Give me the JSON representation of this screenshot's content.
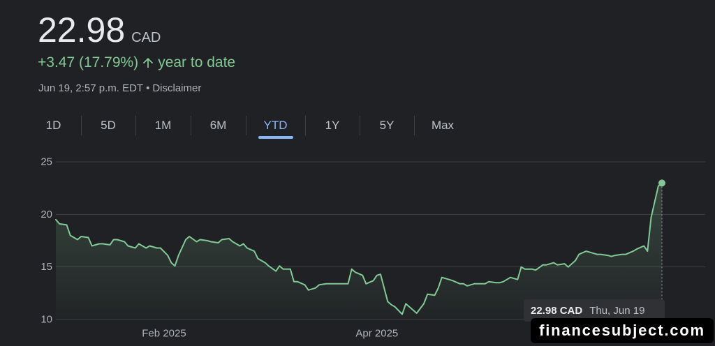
{
  "quote": {
    "price": "22.98",
    "currency": "CAD",
    "change": "+3.47 (17.79%)",
    "change_icon": "arrow-up-icon",
    "change_period": "year to date",
    "timestamp": "Jun 19, 2:57 p.m. EDT",
    "separator": "•",
    "disclaimer": "Disclaimer"
  },
  "range_tabs": {
    "items": [
      "1D",
      "5D",
      "1M",
      "6M",
      "YTD",
      "1Y",
      "5Y",
      "Max"
    ],
    "selected": "YTD"
  },
  "colors": {
    "background": "#202124",
    "text": "#e8eaed",
    "positive": "#81c995",
    "muted": "#9aa0a6",
    "accent": "#8ab4f8",
    "grid": "#3c4043"
  },
  "watermark": "financesubject.com",
  "chart_data": {
    "type": "line",
    "xlim": [
      "2025-01-02",
      "2025-06-19"
    ],
    "ylim": [
      10,
      25
    ],
    "grid": true,
    "y_ticks": [
      {
        "value": 25,
        "label": "25"
      },
      {
        "value": 20,
        "label": "20"
      },
      {
        "value": 15,
        "label": "15"
      },
      {
        "value": 10,
        "label": "10"
      }
    ],
    "x_ticks": [
      {
        "value": "2025-02-01",
        "label": "Feb 2025"
      },
      {
        "value": "2025-04-01",
        "label": "Apr 2025"
      }
    ],
    "series": [
      {
        "color": "#81c995",
        "x": [
          "2025-01-02",
          "2025-01-03",
          "2025-01-05",
          "2025-01-06",
          "2025-01-08",
          "2025-01-09",
          "2025-01-11",
          "2025-01-12",
          "2025-01-14",
          "2025-01-15",
          "2025-01-17",
          "2025-01-18",
          "2025-01-19",
          "2025-01-21",
          "2025-01-22",
          "2025-01-24",
          "2025-01-25",
          "2025-01-27",
          "2025-01-28",
          "2025-01-30",
          "2025-01-31",
          "2025-02-02",
          "2025-02-03",
          "2025-02-04",
          "2025-02-05",
          "2025-02-07",
          "2025-02-08",
          "2025-02-10",
          "2025-02-11",
          "2025-02-13",
          "2025-02-14",
          "2025-02-16",
          "2025-02-17",
          "2025-02-19",
          "2025-02-20",
          "2025-02-22",
          "2025-02-23",
          "2025-02-24",
          "2025-02-26",
          "2025-02-27",
          "2025-03-01",
          "2025-03-02",
          "2025-03-04",
          "2025-03-05",
          "2025-03-06",
          "2025-03-08",
          "2025-03-09",
          "2025-03-10",
          "2025-03-12",
          "2025-03-13",
          "2025-03-15",
          "2025-03-16",
          "2025-03-18",
          "2025-03-19",
          "2025-03-20",
          "2025-03-22",
          "2025-03-24",
          "2025-03-25",
          "2025-03-26",
          "2025-03-28",
          "2025-03-29",
          "2025-03-31",
          "2025-04-01",
          "2025-04-02",
          "2025-04-04",
          "2025-04-05",
          "2025-04-06",
          "2025-04-08",
          "2025-04-09",
          "2025-04-11",
          "2025-04-12",
          "2025-04-14",
          "2025-04-15",
          "2025-04-17",
          "2025-04-18",
          "2025-04-19",
          "2025-04-21",
          "2025-04-22",
          "2025-04-24",
          "2025-04-25",
          "2025-04-26",
          "2025-04-28",
          "2025-04-29",
          "2025-05-01",
          "2025-05-02",
          "2025-05-04",
          "2025-05-05",
          "2025-05-06",
          "2025-05-08",
          "2025-05-10",
          "2025-05-11",
          "2025-05-12",
          "2025-05-14",
          "2025-05-15",
          "2025-05-17",
          "2025-05-18",
          "2025-05-20",
          "2025-05-21",
          "2025-05-23",
          "2025-05-24",
          "2025-05-26",
          "2025-05-27",
          "2025-05-29",
          "2025-05-30",
          "2025-06-01",
          "2025-06-02",
          "2025-06-04",
          "2025-06-05",
          "2025-06-06",
          "2025-06-08",
          "2025-06-09",
          "2025-06-11",
          "2025-06-12",
          "2025-06-14",
          "2025-06-15",
          "2025-06-16",
          "2025-06-18",
          "2025-06-19"
        ],
        "y": [
          19.5,
          19.1,
          19.0,
          18.0,
          17.6,
          17.9,
          17.8,
          17.0,
          17.2,
          17.2,
          17.1,
          17.6,
          17.6,
          17.4,
          17.0,
          16.8,
          17.2,
          16.8,
          17.0,
          16.8,
          16.8,
          16.1,
          15.4,
          15.1,
          16.1,
          17.6,
          17.9,
          17.4,
          17.6,
          17.5,
          17.4,
          17.3,
          17.6,
          17.7,
          17.4,
          17.0,
          17.2,
          16.8,
          16.5,
          15.8,
          15.4,
          15.1,
          14.6,
          15.1,
          14.8,
          14.8,
          13.6,
          13.6,
          13.3,
          12.8,
          13.0,
          13.3,
          13.4,
          13.4,
          13.4,
          13.4,
          13.4,
          14.8,
          14.5,
          14.2,
          13.4,
          13.7,
          14.2,
          14.3,
          11.7,
          11.4,
          11.2,
          10.5,
          11.5,
          10.9,
          10.6,
          11.5,
          12.4,
          12.3,
          13.0,
          14.0,
          13.8,
          13.7,
          13.4,
          13.4,
          13.2,
          13.4,
          13.4,
          13.4,
          13.6,
          13.5,
          13.5,
          13.6,
          14.0,
          13.8,
          15.0,
          14.8,
          14.8,
          14.7,
          15.2,
          15.2,
          15.4,
          15.2,
          15.3,
          15.0,
          15.6,
          16.2,
          16.5,
          16.4,
          16.2,
          16.2,
          16.1,
          16.0,
          16.1,
          16.2,
          16.2,
          16.5,
          16.7,
          17.0,
          16.5,
          19.7,
          22.7,
          22.98
        ]
      }
    ],
    "hover": {
      "x": "2025-06-19",
      "y": 22.98,
      "value_label": "22.98 CAD",
      "date_label": "Thu, Jun 19"
    }
  }
}
